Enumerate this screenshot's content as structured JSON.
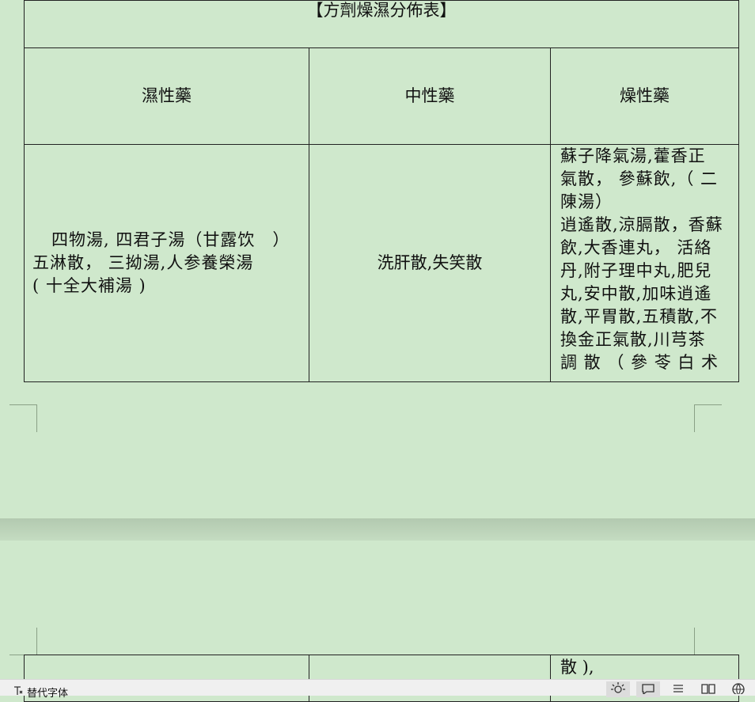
{
  "table": {
    "title": "【方劑燥濕分佈表】",
    "headers": [
      "濕性藥",
      "中性藥",
      "燥性藥"
    ],
    "wet_lines": [
      "四物湯, 四君子湯（甘露饮　）",
      "五淋散， 三拗湯,人参養榮湯",
      "( 十全大補湯 )"
    ],
    "neutral": "洗肝散,失笑散",
    "dry_lines": [
      "蘇子降氣湯,藿香正",
      "氣散， 參蘇飲,（ 二",
      "陳湯）",
      "逍遙散,涼膈散，香蘇",
      "飲,大香連丸， 活絡",
      "丹,附子理中丸,肥兒",
      "丸,安中散,加味逍遙",
      "散,平胃散,五積散,不",
      "換金正氣散,川芎茶",
      "調 散 （ 參 苓 白 术"
    ],
    "continuation": "散 ),"
  },
  "statusbar": {
    "left_label": "替代字体"
  }
}
